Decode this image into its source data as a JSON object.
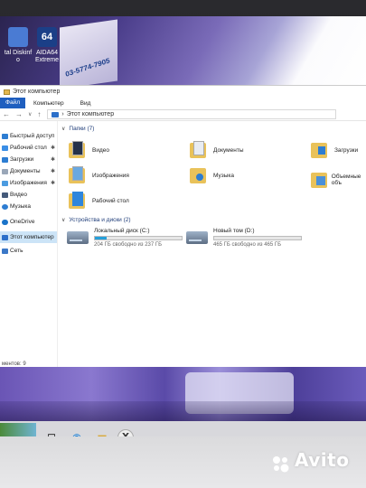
{
  "desktop": {
    "icons": [
      {
        "label": "tal Diskinf o",
        "icon": "crystaldiskinfo-icon"
      },
      {
        "label": "AIDA64 Extreme",
        "icon": "aida64-icon"
      }
    ],
    "poster_text": "03-5774-7905"
  },
  "window": {
    "title": "Этот компьютер",
    "ribbon": {
      "file": "Файл",
      "tabs": [
        "Компьютер",
        "Вид"
      ]
    },
    "address": {
      "path": "Этот компьютер"
    },
    "nav": [
      {
        "label": "Быстрый доступ",
        "icon": "star-icon",
        "pinned": false
      },
      {
        "label": "Рабочий стол",
        "icon": "desktop-folder-icon",
        "pinned": true
      },
      {
        "label": "Загрузки",
        "icon": "download-icon",
        "pinned": true
      },
      {
        "label": "Документы",
        "icon": "documents-icon",
        "pinned": true
      },
      {
        "label": "Изображения",
        "icon": "pictures-icon",
        "pinned": true
      },
      {
        "label": "Видео",
        "icon": "video-icon",
        "pinned": false
      },
      {
        "label": "Музыка",
        "icon": "music-icon",
        "pinned": false
      },
      {
        "label": "OneDrive",
        "icon": "cloud-icon",
        "pinned": false
      },
      {
        "label": "Этот компьютер",
        "icon": "computer-icon",
        "pinned": false,
        "selected": true
      },
      {
        "label": "Сеть",
        "icon": "network-icon",
        "pinned": false
      }
    ],
    "folders_header": "Папки (7)",
    "folders": [
      {
        "label": "Видео"
      },
      {
        "label": "Документы"
      },
      {
        "label": "Загрузки"
      },
      {
        "label": "Изображения"
      },
      {
        "label": "Музыка"
      },
      {
        "label": "Объемные объ"
      },
      {
        "label": "Рабочий стол"
      }
    ],
    "drives_header": "Устройства и диски (2)",
    "drives": [
      {
        "label": "Локальный диск (C:)",
        "free_text": "204 ГБ свободно из 237 ГБ",
        "used_fraction": 0.14
      },
      {
        "label": "Новый том (D:)",
        "free_text": "465 ГБ свободно из 465 ГБ",
        "used_fraction": 0.0
      }
    ],
    "status": "ментов: 9"
  },
  "taskbar": {
    "search_icon": "search-icon",
    "apps": [
      "task-view-icon",
      "edge-icon",
      "explorer-icon",
      "yandex-icon"
    ],
    "yandex_letter": "Y"
  },
  "watermark": "Avito",
  "colors": {
    "accent": "#26a0da",
    "folder": "#e9c25a",
    "selection": "#cce4f7"
  }
}
